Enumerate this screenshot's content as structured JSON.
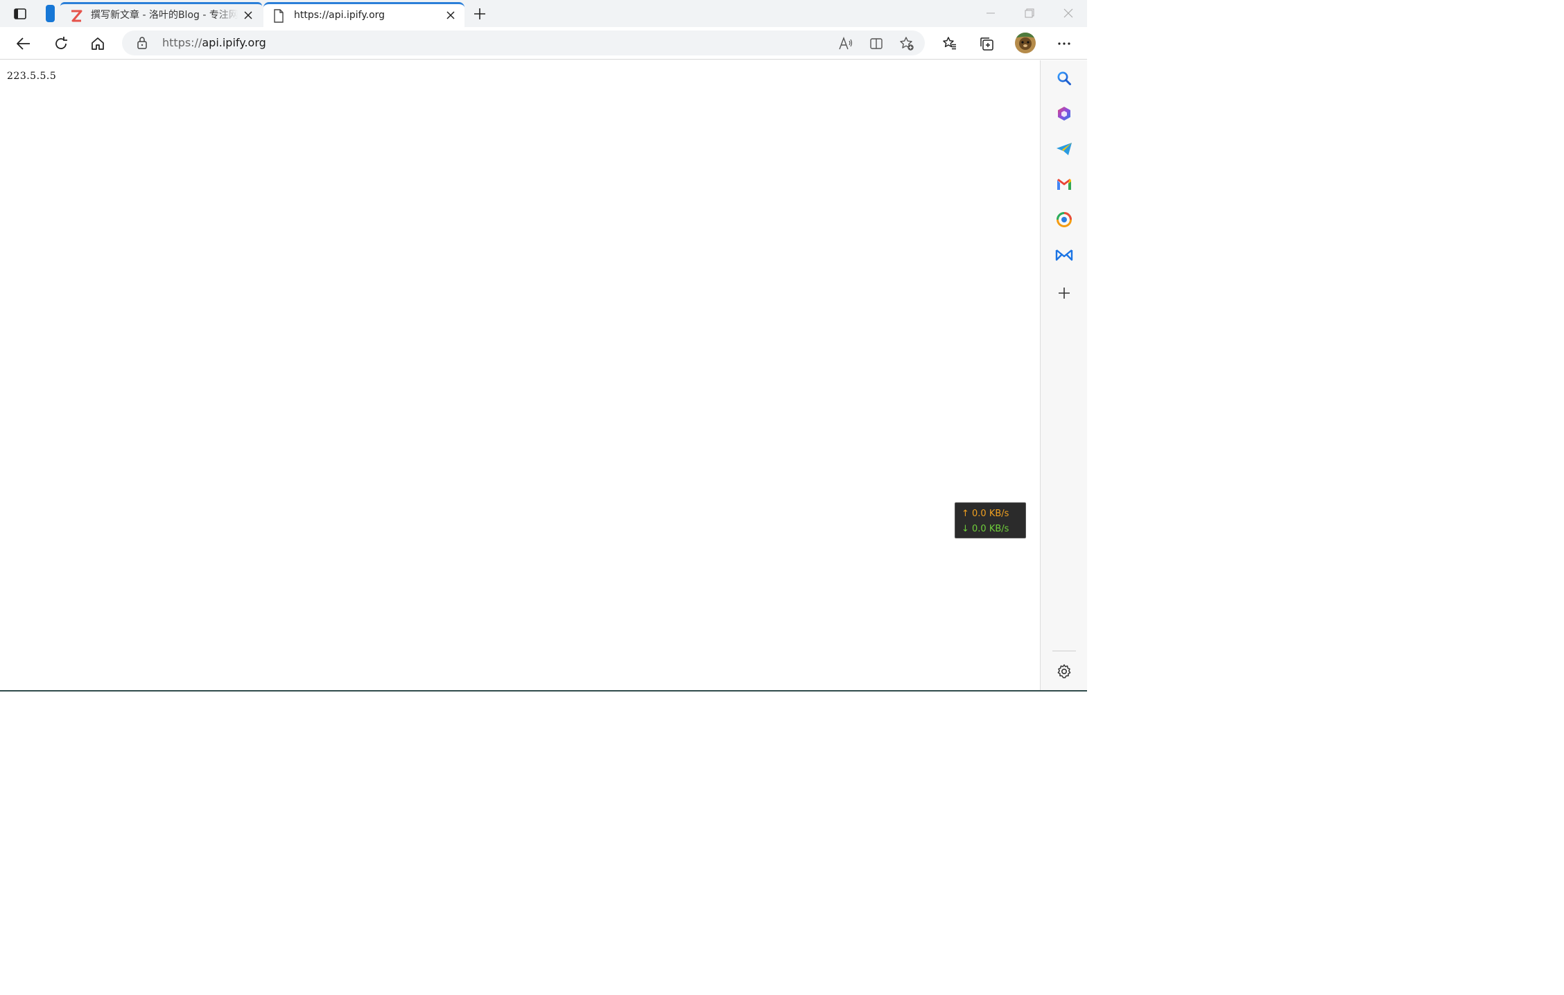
{
  "browser": {
    "tabs": [
      {
        "title": "撰写新文章 - 洛叶的Blog - 专注网",
        "active": false,
        "favicon": "z-logo-icon"
      },
      {
        "title": "https://api.ipify.org",
        "active": true,
        "favicon": "page-icon"
      }
    ],
    "address_bar": {
      "url_scheme": "https://",
      "url_host": "api.ipify.org"
    }
  },
  "page": {
    "ip_address": "223.5.5.5"
  },
  "net_speed": {
    "upload": "↑ 0.0 KB/s",
    "download": "↓ 0.0 KB/s"
  },
  "sidebar": {
    "items": [
      {
        "name": "search-icon"
      },
      {
        "name": "office-icon"
      },
      {
        "name": "telegram-icon"
      },
      {
        "name": "gmail-icon"
      },
      {
        "name": "app-icon"
      },
      {
        "name": "outlook-icon"
      },
      {
        "name": "add-icon"
      }
    ]
  },
  "colors": {
    "accent": "#1777d6",
    "upload_speed": "#f0a020",
    "download_speed": "#6fcf3a"
  }
}
